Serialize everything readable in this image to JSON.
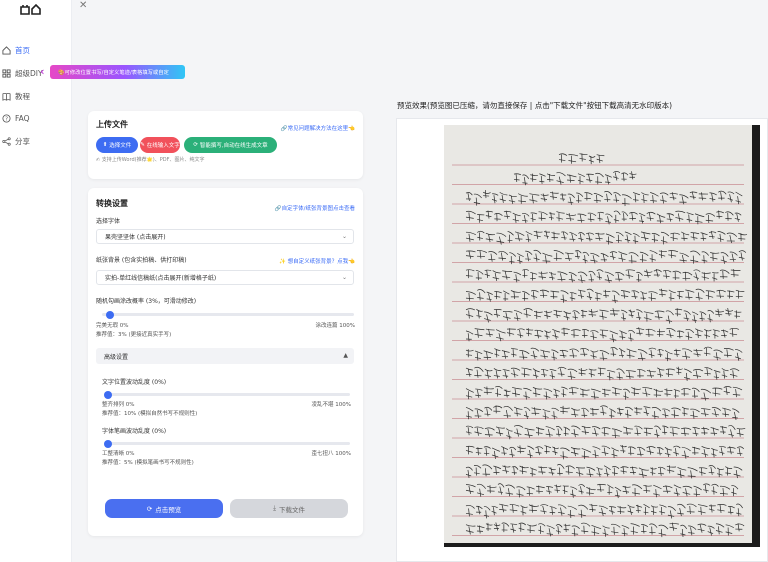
{
  "sidebar": {
    "items": [
      {
        "label": "首页",
        "icon": "home-icon",
        "active": true
      },
      {
        "label": "超级DIY",
        "icon": "grid-icon",
        "active": false
      },
      {
        "label": "教程",
        "icon": "book-icon",
        "active": false
      },
      {
        "label": "FAQ",
        "icon": "help-icon",
        "active": false
      },
      {
        "label": "分享",
        "icon": "share-icon",
        "active": false
      }
    ]
  },
  "diy_banner": "🎨可修改位置书写/自定义笔迹/表格填写或自定",
  "upload": {
    "title": "上传文件",
    "help": "🔗常见问题解决方法在这里👈",
    "choose_file": "选择文件",
    "input_text": "在线输入文字",
    "ai_article": "智能撰写,自动在线生成文章",
    "support": "✍ 支持上传Word(推荐🌟)、PDF、图片、纯文字"
  },
  "convert": {
    "title": "转换设置",
    "custom_link": "🔗自定字体/纸张背景图点击查看",
    "font_label": "选择字体",
    "font_value": "果壳坚坚体 (点击展开)",
    "paper_label": "纸张背景 (包含实拍稿、供打印稿)",
    "paper_hint": "✨ 想自定义纸张背景？点我👈",
    "paper_value": "实拍-单红线信稿纸(点击展开(新增格子纸)",
    "typo_label": "随机勾画涂改概率 (3%，可滑动修改)",
    "typo_left": "完美无瑕 0%",
    "typo_right": "涂改连篇 100%",
    "typo_recommend": "推荐值：3% (更接近真实手写)",
    "typo_value": 0.03,
    "advanced": "高级设置",
    "pos_label": "文字位置波动乱度 (0%)",
    "pos_left": "整齐排列 0%",
    "pos_right": "凌乱不堪 100%",
    "pos_recommend": "推荐值：10% (模拟自然书写不规则性)",
    "pos_value": 0.0,
    "stroke_label": "字体笔画波动乱度 (0%)",
    "stroke_left": "工整清晰 0%",
    "stroke_right": "歪七扭八 100%",
    "stroke_recommend": "推荐值：5% (模拟笔画书写不规则性)",
    "stroke_value": 0.0,
    "preview_btn": "点击预览",
    "download_btn": "下载文件"
  },
  "preview": {
    "title": "预览效果(预览图已压缩，请勿直接保存 | 点击\"下载文件\"按钮下载高清无水印版本)"
  },
  "colors": {
    "accent": "#3d6cf2",
    "red": "#f1515b",
    "green": "#2bb079"
  }
}
